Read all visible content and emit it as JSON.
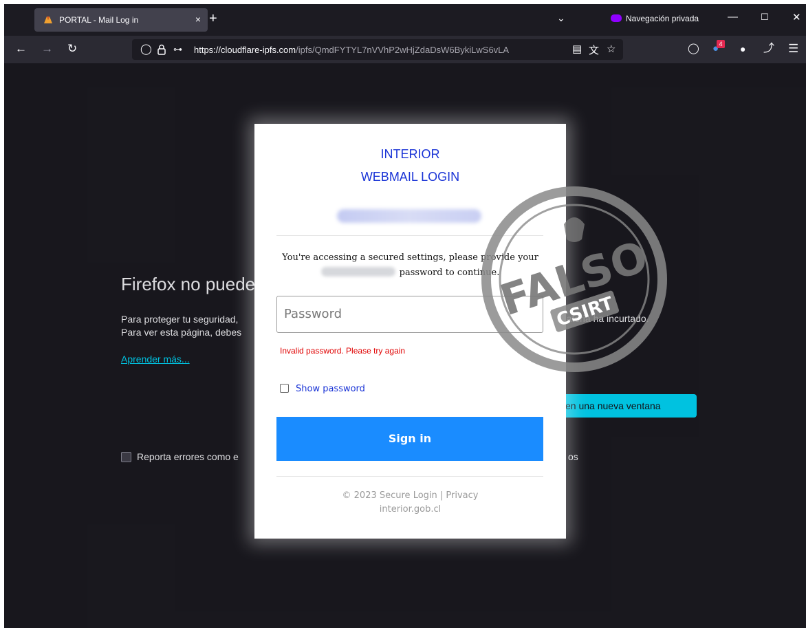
{
  "browser": {
    "tab_title": "PORTAL - Mail Log in",
    "new_tab": "+",
    "tab_close": "×",
    "private_label": "Navegación privada",
    "url_domain": "https://cloudflare-ipfs.com",
    "url_path": "/ipfs/QmdFYTYL7nVVhP2wHjZdaDsW6BykiLwS6vLA",
    "extension_badge": "4"
  },
  "error_page": {
    "title": "Firefox no puede",
    "line1": "Para proteger tu seguridad,",
    "line1_tail": "o ateria ha incurtado.",
    "line2": "Para ver esta página, debes",
    "learn_more": "Aprender más...",
    "open_window": "en una nueva ventana",
    "report_label": "Reporta errores como e",
    "report_tail": "os"
  },
  "modal": {
    "title_line1": "INTERIOR",
    "title_line2": "WEBMAIL LOGIN",
    "message_line1": "You're accessing a secured settings, please provide your",
    "message_line2": "password to continue.",
    "password_placeholder": "Password",
    "error": "Invalid password. Please try again",
    "show_password": "Show password",
    "sign_in": "Sign in",
    "footer_line1": "© 2023 Secure Login | Privacy",
    "footer_line2": "interior.gob.cl"
  },
  "stamp": {
    "word": "FALSO",
    "org": "CSIRT"
  },
  "colors": {
    "accent": "#1a8cff",
    "title_blue": "#1a34d6",
    "error_red": "#e00000",
    "cyan_button": "#00ddff"
  }
}
